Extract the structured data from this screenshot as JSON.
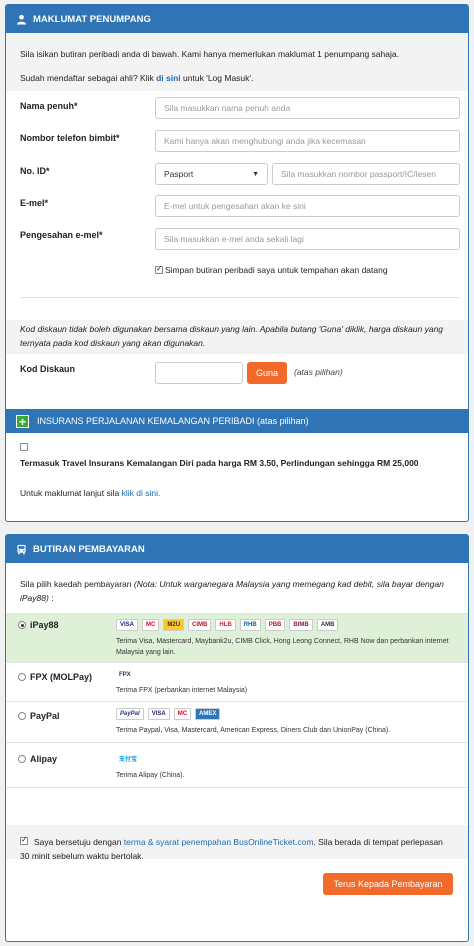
{
  "passenger": {
    "header": "MAKLUMAT PENUMPANG",
    "intro": "Sila isikan butiran peribadi anda di bawah. Kami hanya memerlukan maklumat 1 penumpang sahaja.",
    "member_prefix": "Sudah mendaftar sebagai ahli? Klik",
    "member_link": "di sini",
    "member_suffix": "untuk 'Log Masuk'.",
    "name_label": "Nama penuh*",
    "name_placeholder": "Sila masukkan nama penuh anda",
    "phone_label": "Nombor telefon bimbit*",
    "phone_placeholder": "Kami hanya akan menghubungi anda jika kecemasan",
    "id_label": "No. ID*",
    "id_type": "Pasport",
    "id_placeholder": "Sila masukkan nombor passport/IC/lesen",
    "email_label": "E-mel*",
    "email_placeholder": "E-mel untuk pengesahan akan ke sini",
    "email_confirm_label": "Pengesahan e-mel*",
    "email_confirm_placeholder": "Sila masukkan e-mel anda sekali lagi",
    "save_details": "Simpan butiran peribadi saya untuk tempahan akan datang"
  },
  "discount": {
    "note": "Kod diskaun tidak boleh digunakan bersama diskaun yang lain. Apabila butang 'Guna' diklik, harga diskaun yang ternyata pada kod diskaun yang akan digunakan.",
    "label": "Kod Diskaun",
    "button": "Guna",
    "optional": "(atas pilihan)"
  },
  "insurance": {
    "header": "INSURANS PERJALANAN KEMALANGAN PERIBADI (atas pilihan)",
    "text": "Termasuk Travel Insurans Kemalangan Diri pada harga RM 3.50, Perlindungan sehingga RM 25,000",
    "more_prefix": "Untuk maklumat lanjut sila",
    "more_link": "klik di sini."
  },
  "payment": {
    "header": "BUTIRAN PEMBAYARAN",
    "intro_plain": "Sila pilih kaedah pembayaran",
    "intro_italic": "(Nota: Untuk warganegara Malaysia yang memegang kad debit, sila bayar dengan iPay88)",
    "intro_end": ":",
    "methods": [
      {
        "name": "iPay88",
        "desc": "Terima Visa, Mastercard, Maybank2u, CIMB Click, Hong Leong Connect, RHB Now dan perbankan internet Malaysia yang lain.",
        "logos": [
          "VISA",
          "MC",
          "M2U",
          "CIMB",
          "HLB",
          "RHB",
          "PBB",
          "BIMB",
          "AMB"
        ]
      },
      {
        "name": "FPX (MOLPay)",
        "desc": "Terima FPX (perbankan internet Malaysia)",
        "logos": [
          "FPX"
        ]
      },
      {
        "name": "PayPal",
        "desc": "Terima Paypal, Visa, Mastercard, American Express, Diners Club dan UnionPay (China).",
        "logos": [
          "PayPal",
          "VISA",
          "MC",
          "AMEX"
        ]
      },
      {
        "name": "Alipay",
        "desc": "Terima Alipay (China).",
        "logos": [
          "支付宝"
        ]
      }
    ],
    "terms_prefix": "Saya bersetuju dengan",
    "terms_link": "terma & syarat penempahan BusOnlineTicket.com",
    "terms_suffix": ". Sila berada di tempat perlepasan 30 minit sebelum waktu bertolak.",
    "continue_button": "Terus Kepada Pembayaran"
  },
  "colors": {
    "primary": "#2f74b5",
    "accent": "#f26a2a",
    "selected_row": "#dff0d8",
    "link": "#1a6bb3"
  }
}
